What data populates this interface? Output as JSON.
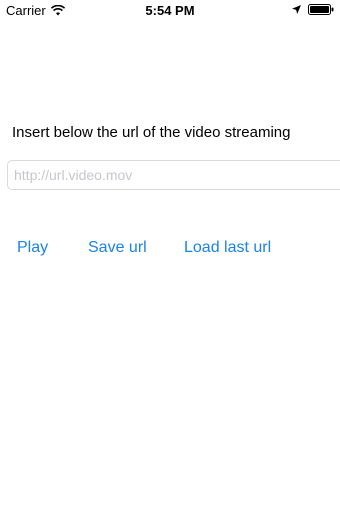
{
  "status_bar": {
    "carrier": "Carrier",
    "time": "5:54 PM"
  },
  "main": {
    "prompt": "Insert below the url of the video streaming",
    "url_input": {
      "value": "",
      "placeholder": "http://url.video.mov"
    },
    "buttons": {
      "play": "Play",
      "save": "Save url",
      "load": "Load last url"
    }
  },
  "colors": {
    "accent": "#1a82e8",
    "placeholder": "#c7c7cd",
    "field_border": "#d9d9d9"
  },
  "icons": [
    "wifi-icon",
    "location-icon",
    "battery-icon"
  ]
}
